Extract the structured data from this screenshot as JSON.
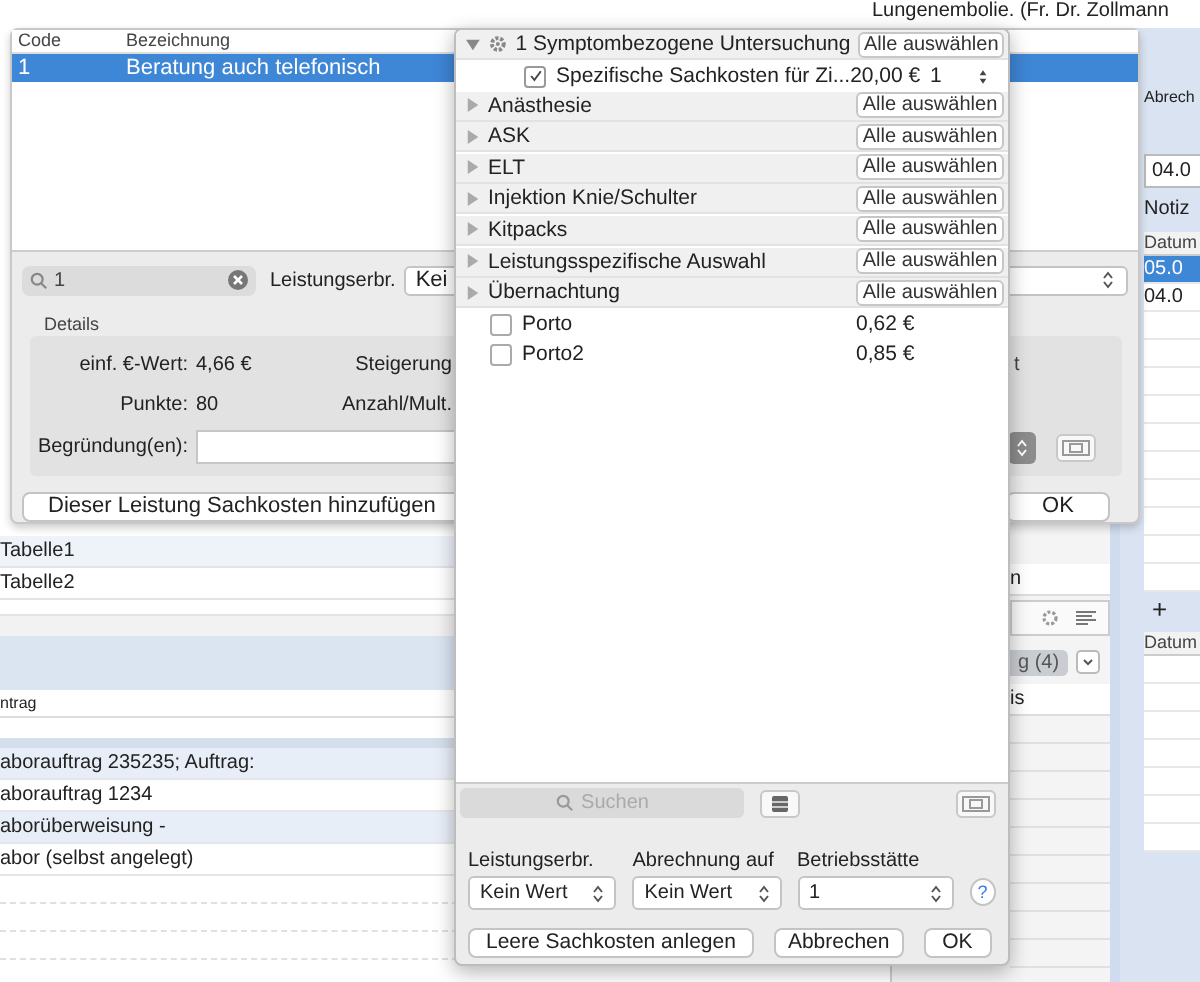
{
  "window_title": "Lungenembolie. (Fr. Dr. Zollmann",
  "background": {
    "table_rows": [
      "Tabelle1",
      "Tabelle2"
    ],
    "list_header": "ntrag",
    "entries": [
      "aborauftrag 235235; Auftrag:",
      "aborauftrag 1234",
      "aborüberweisung -",
      "abor (selbst angelegt)"
    ],
    "middle": {
      "label": "n",
      "tab": "g (4)",
      "column": "is"
    },
    "right_panel": {
      "label": "Abrech",
      "date": "04.0",
      "notes_label": "Notiz",
      "table_header": "Datum",
      "rows": [
        {
          "text": "05.0",
          "selected": true
        },
        {
          "text": "04.0",
          "selected": false
        }
      ],
      "add_button": "+",
      "table2_header": "Datum"
    }
  },
  "service_popover": {
    "columns": [
      "Code",
      "Bezeichnung"
    ],
    "rows": [
      {
        "code": "1",
        "name": "Beratung auch telefonisch",
        "selected": true
      }
    ],
    "search": {
      "value": "1"
    },
    "provider_label": "Leistungserbr.",
    "provider_value": "Kei",
    "details": {
      "title": "Details",
      "fields": [
        {
          "label": "einf. €-Wert:",
          "value": "4,66 €",
          "side_label": "Steigerung"
        },
        {
          "label": "Punkte:",
          "value": "80",
          "side_label": "Anzahl/Mult."
        }
      ],
      "reason_label": "Begründung(en):",
      "cut_label": "t"
    },
    "add_button": "Dieser Leistung Sachkosten hinzufügen",
    "ok_button": "OK"
  },
  "material_popover": {
    "groups": [
      {
        "name": "1 Symptombezogene Untersuchung",
        "expanded": true,
        "button": "Alle auswählen",
        "items": [
          {
            "name": "Spezifische Sachkosten für Zi...",
            "checked": true,
            "price": "20,00 €",
            "quantity": "1"
          }
        ]
      },
      {
        "name": "Anästhesie",
        "expanded": false,
        "button": "Alle auswählen"
      },
      {
        "name": "ASK",
        "expanded": false,
        "button": "Alle auswählen"
      },
      {
        "name": "ELT",
        "expanded": false,
        "button": "Alle auswählen"
      },
      {
        "name": "Injektion Knie/Schulter",
        "expanded": false,
        "button": "Alle auswählen"
      },
      {
        "name": "Kitpacks",
        "expanded": false,
        "button": "Alle auswählen"
      },
      {
        "name": "Leistungsspezifische Auswahl",
        "expanded": false,
        "button": "Alle auswählen"
      },
      {
        "name": "Übernachtung",
        "expanded": false,
        "button": "Alle auswählen"
      }
    ],
    "items": [
      {
        "name": "Porto",
        "checked": false,
        "price": "0,62 €"
      },
      {
        "name": "Porto2",
        "checked": false,
        "price": "0,85 €"
      }
    ],
    "search": {
      "placeholder": "Suchen"
    },
    "fields": [
      {
        "label": "Leistungserbr.",
        "value": "Kein Wert"
      },
      {
        "label": "Abrechnung auf",
        "value": "Kein Wert"
      },
      {
        "label": "Betriebsstätte",
        "value": "1"
      }
    ],
    "help": "?",
    "buttons": [
      "Leere Sachkosten anlegen",
      "Abbrechen",
      "OK"
    ]
  }
}
